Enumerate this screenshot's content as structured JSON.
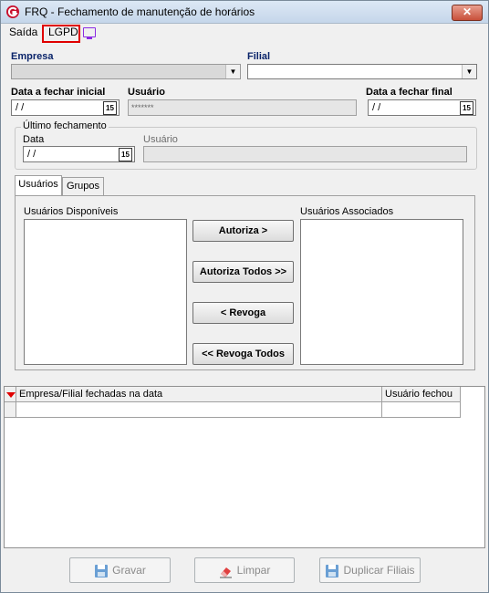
{
  "window": {
    "title": "FRQ - Fechamento de manutenção de horários",
    "close_symbol": "✕"
  },
  "menu": {
    "items": [
      {
        "label": "Saída"
      },
      {
        "label": "LGPD"
      }
    ]
  },
  "form": {
    "empresa_label": "Empresa",
    "filial_label": "Filial",
    "data_inicial_label": "Data a fechar inicial",
    "data_inicial_value": "/ /",
    "usuario_label": "Usuário",
    "usuario_value": "*******",
    "data_final_label": "Data a fechar final",
    "data_final_value": "/ /",
    "calendar_glyph": "15"
  },
  "ultimo_fechamento": {
    "legend": "Último fechamento",
    "data_label": "Data",
    "data_value": "/ /",
    "usuario_label": "Usuário",
    "usuario_value": ""
  },
  "tabs": [
    {
      "label": "Usuários",
      "active": true
    },
    {
      "label": "Grupos",
      "active": false
    }
  ],
  "users_panel": {
    "disponiveis_label": "Usuários Disponíveis",
    "associados_label": "Usuários Associados",
    "buttons": {
      "autoriza": "Autoriza >",
      "autoriza_todos": "Autoriza Todos >>",
      "revoga": "< Revoga",
      "revoga_todos": "<< Revoga Todos"
    }
  },
  "grid": {
    "columns": [
      "Empresa/Filial fechadas na data",
      "Usuário fechou"
    ],
    "rows": [
      [
        "",
        ""
      ]
    ]
  },
  "footer": {
    "gravar": "Gravar",
    "limpar": "Limpar",
    "duplicar": "Duplicar Filiais"
  },
  "colors": {
    "title_accent": "#c8102e",
    "lgpd_highlight": "#e00000",
    "monitor_icon": "#8a2be2"
  }
}
